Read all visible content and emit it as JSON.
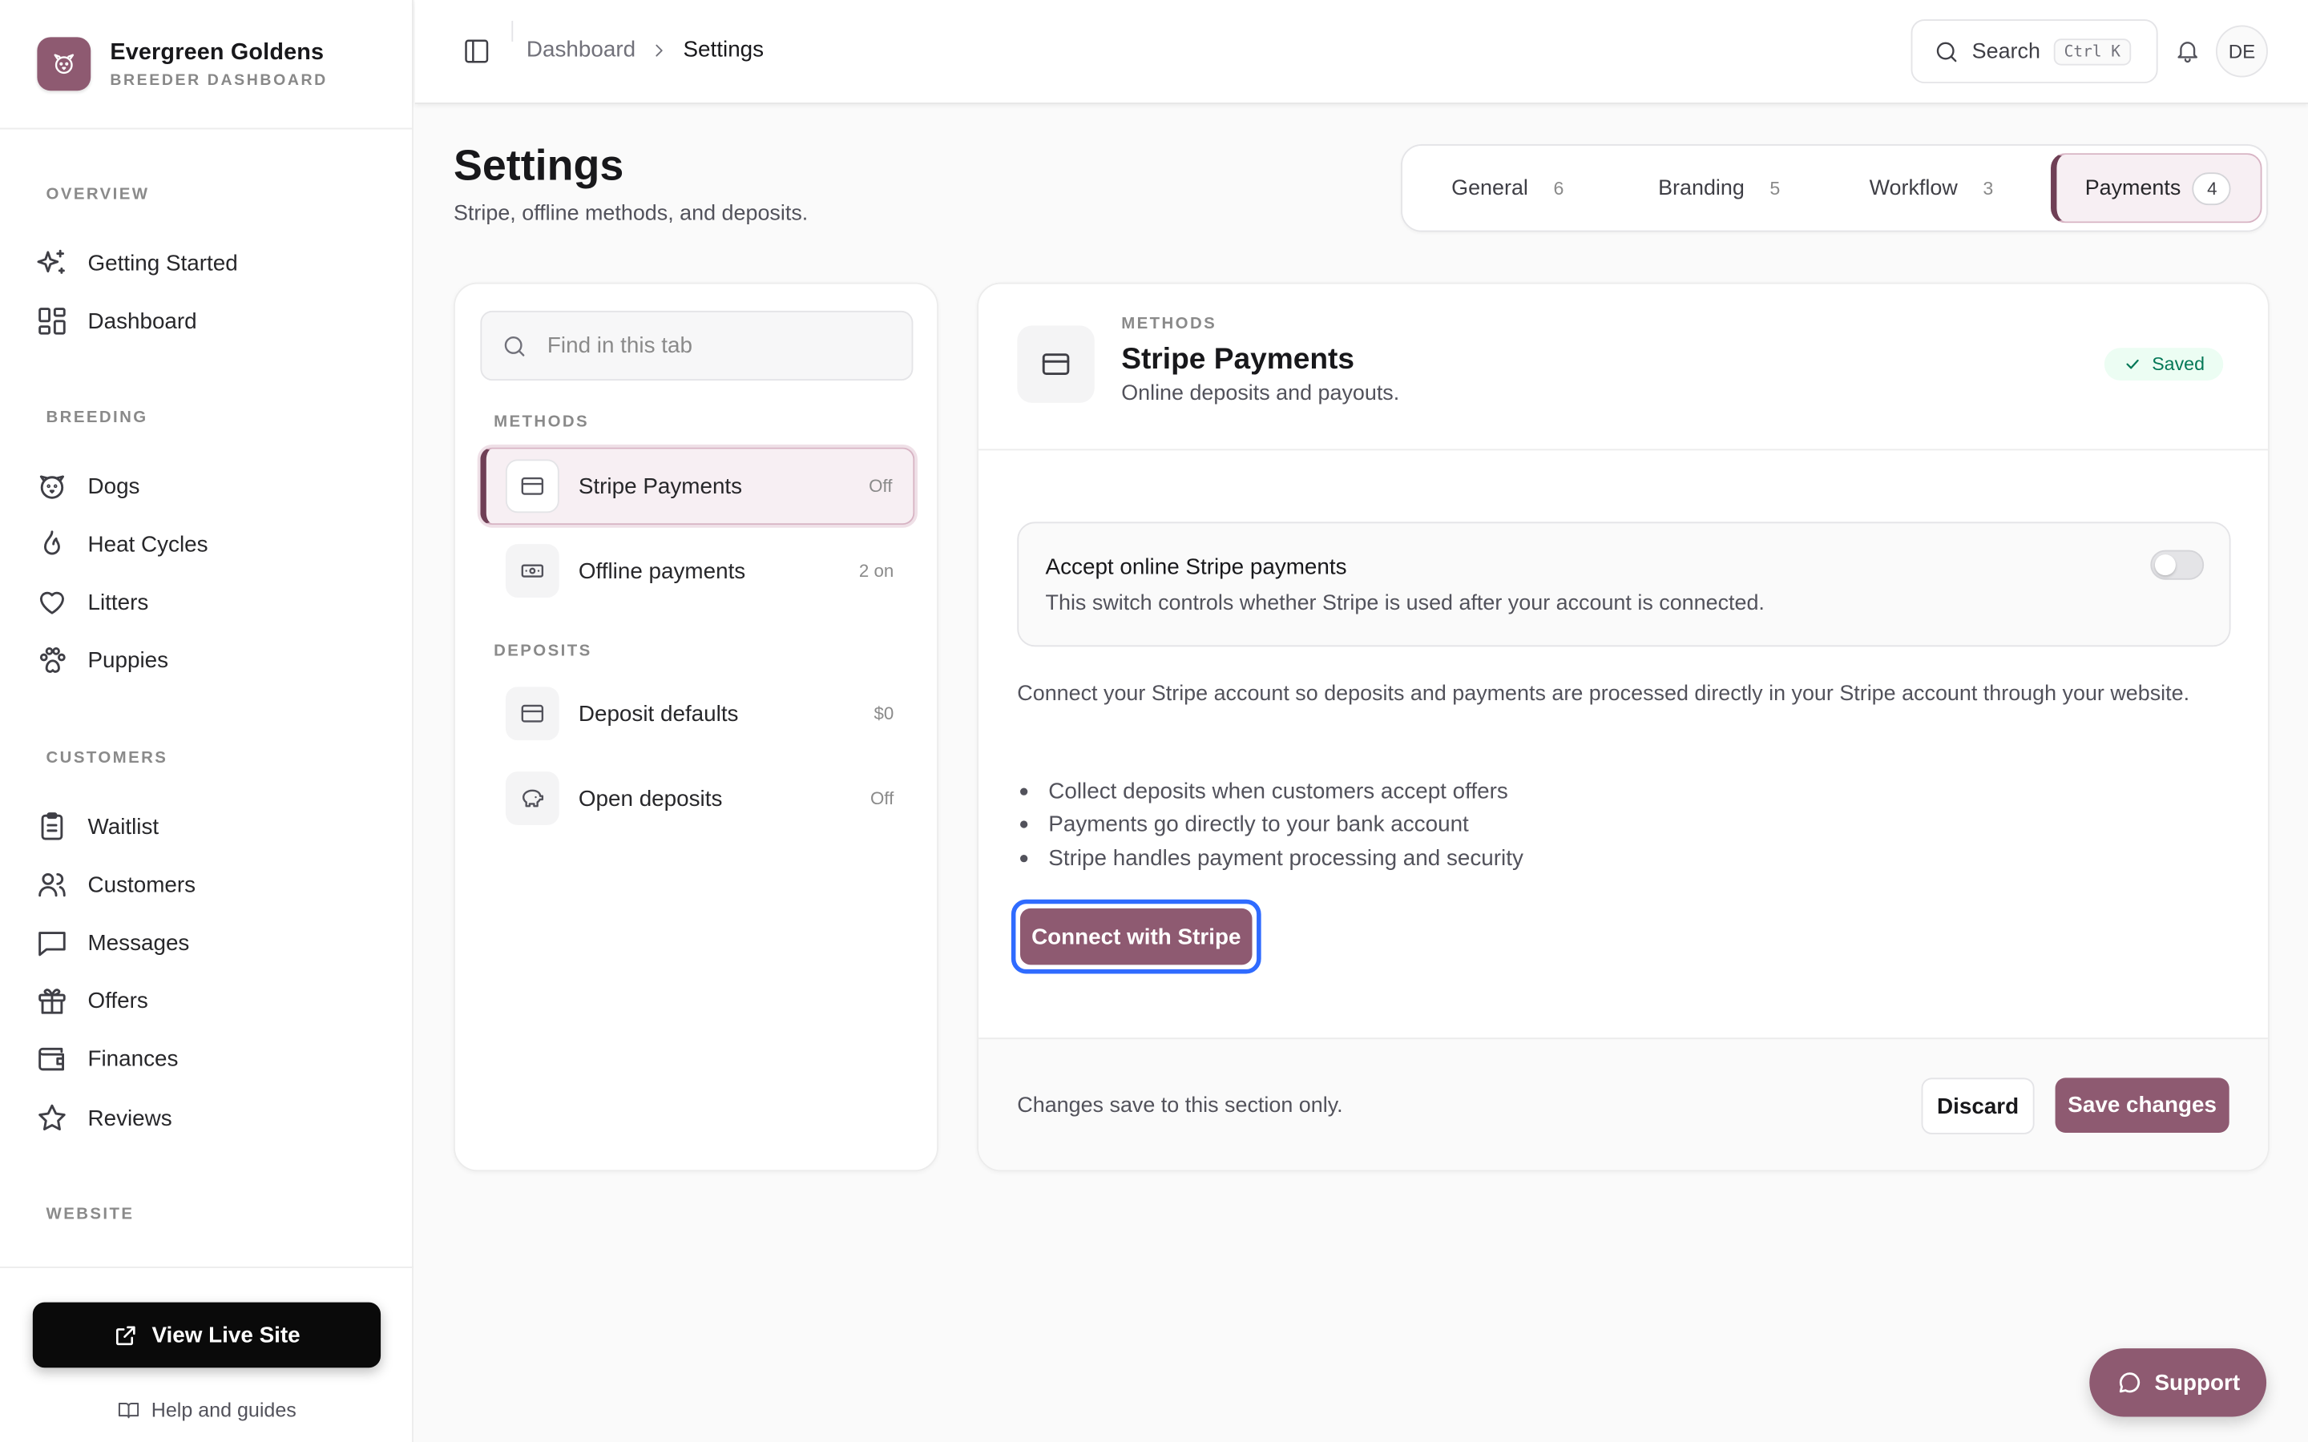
{
  "brand": {
    "name": "Evergreen Goldens",
    "subtitle": "BREEDER DASHBOARD"
  },
  "sidebar": {
    "sections": [
      {
        "heading": "OVERVIEW",
        "items": [
          {
            "label": "Getting Started",
            "icon": "sparkles-icon"
          },
          {
            "label": "Dashboard",
            "icon": "grid-icon"
          }
        ]
      },
      {
        "heading": "BREEDING",
        "items": [
          {
            "label": "Dogs",
            "icon": "dog-icon"
          },
          {
            "label": "Heat Cycles",
            "icon": "flame-icon"
          },
          {
            "label": "Litters",
            "icon": "heart-icon"
          },
          {
            "label": "Puppies",
            "icon": "paw-icon"
          }
        ]
      },
      {
        "heading": "CUSTOMERS",
        "items": [
          {
            "label": "Waitlist",
            "icon": "clipboard-icon"
          },
          {
            "label": "Customers",
            "icon": "users-icon"
          },
          {
            "label": "Messages",
            "icon": "message-icon"
          },
          {
            "label": "Offers",
            "icon": "gift-icon"
          },
          {
            "label": "Finances",
            "icon": "wallet-icon"
          },
          {
            "label": "Reviews",
            "icon": "star-icon"
          }
        ]
      },
      {
        "heading": "WEBSITE",
        "items": []
      }
    ],
    "view_live": "View Live Site",
    "help": "Help and guides"
  },
  "topbar": {
    "breadcrumb": [
      "Dashboard",
      "Settings"
    ],
    "search_label": "Search",
    "search_shortcut": "Ctrl K",
    "avatar_initials": "DE"
  },
  "page": {
    "title": "Settings",
    "subtitle": "Stripe, offline methods, and deposits."
  },
  "tabs": [
    {
      "label": "General",
      "count": "6"
    },
    {
      "label": "Branding",
      "count": "5"
    },
    {
      "label": "Workflow",
      "count": "3"
    },
    {
      "label": "Payments",
      "count": "4",
      "active": true
    }
  ],
  "left_panel": {
    "search_placeholder": "Find in this tab",
    "groups": [
      {
        "label": "METHODS",
        "items": [
          {
            "label": "Stripe Payments",
            "status": "Off",
            "icon": "card-icon",
            "active": true
          },
          {
            "label": "Offline payments",
            "status": "2 on",
            "icon": "cash-icon"
          }
        ]
      },
      {
        "label": "DEPOSITS",
        "items": [
          {
            "label": "Deposit defaults",
            "status": "$0",
            "icon": "card-icon"
          },
          {
            "label": "Open deposits",
            "status": "Off",
            "icon": "piggy-bank-icon"
          }
        ]
      }
    ]
  },
  "detail": {
    "kicker": "METHODS",
    "title": "Stripe Payments",
    "description": "Online deposits and payouts.",
    "status": "Saved",
    "toggle": {
      "title": "Accept online Stripe payments",
      "description": "This switch controls whether Stripe is used after your account is connected.",
      "on": false
    },
    "connect_text": "Connect your Stripe account so deposits and payments are processed directly in your Stripe account through your website.",
    "bullets": [
      "Collect deposits when customers accept offers",
      "Payments go directly to your bank account",
      "Stripe handles payment processing and security"
    ],
    "connect_button": "Connect with Stripe",
    "footer_note": "Changes save to this section only.",
    "discard": "Discard",
    "save": "Save changes"
  },
  "support": "Support",
  "colors": {
    "accent": "#8e5a71",
    "accent_dark": "#6f3f55",
    "focus_ring": "#2f6bff",
    "success": "#047857"
  }
}
